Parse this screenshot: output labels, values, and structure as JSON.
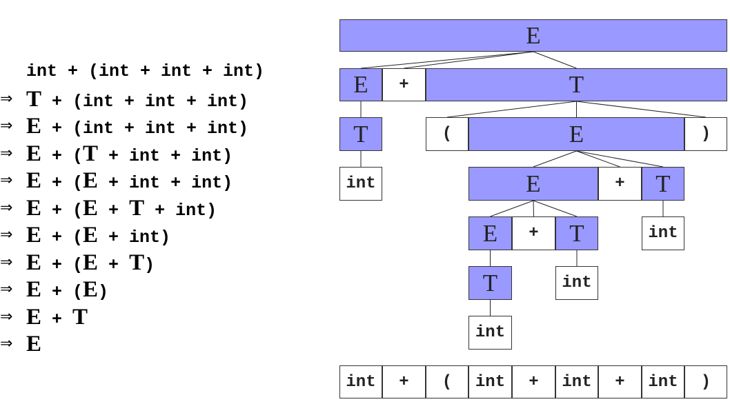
{
  "derivation": {
    "arrow": "⇒",
    "steps": [
      [
        {
          "t": "int + (int + int + int)",
          "k": "t"
        }
      ],
      [
        {
          "t": "T",
          "k": "nt"
        },
        {
          "t": " + (int + int + int)",
          "k": "t"
        }
      ],
      [
        {
          "t": "E",
          "k": "nt"
        },
        {
          "t": " + (int + int + int)",
          "k": "t"
        }
      ],
      [
        {
          "t": "E",
          "k": "nt"
        },
        {
          "t": " + (",
          "k": "t"
        },
        {
          "t": "T",
          "k": "nt"
        },
        {
          "t": " + int + int)",
          "k": "t"
        }
      ],
      [
        {
          "t": "E",
          "k": "nt"
        },
        {
          "t": " + (",
          "k": "t"
        },
        {
          "t": "E",
          "k": "nt"
        },
        {
          "t": " + int + int)",
          "k": "t"
        }
      ],
      [
        {
          "t": "E",
          "k": "nt"
        },
        {
          "t": " + (",
          "k": "t"
        },
        {
          "t": "E",
          "k": "nt"
        },
        {
          "t": " + ",
          "k": "t"
        },
        {
          "t": "T",
          "k": "nt"
        },
        {
          "t": " + int)",
          "k": "t"
        }
      ],
      [
        {
          "t": "E",
          "k": "nt"
        },
        {
          "t": " + (",
          "k": "t"
        },
        {
          "t": "E",
          "k": "nt"
        },
        {
          "t": " + int)",
          "k": "t"
        }
      ],
      [
        {
          "t": "E",
          "k": "nt"
        },
        {
          "t": " + (",
          "k": "t"
        },
        {
          "t": "E",
          "k": "nt"
        },
        {
          "t": " + ",
          "k": "t"
        },
        {
          "t": "T",
          "k": "nt"
        },
        {
          "t": ")",
          "k": "t"
        }
      ],
      [
        {
          "t": "E",
          "k": "nt"
        },
        {
          "t": " + (",
          "k": "t"
        },
        {
          "t": "E",
          "k": "nt"
        },
        {
          "t": ")",
          "k": "t"
        }
      ],
      [
        {
          "t": "E",
          "k": "nt"
        },
        {
          "t": " + ",
          "k": "t"
        },
        {
          "t": "T",
          "k": "nt"
        }
      ],
      [
        {
          "t": "E",
          "k": "nt"
        }
      ]
    ]
  },
  "parse_tree": {
    "nonterminal_color": "#9999ff",
    "terminal_color": "#ffffff",
    "nodes": [
      {
        "id": "root",
        "label": "E",
        "kind": "nt"
      },
      {
        "id": "n1",
        "label": "E",
        "kind": "nt",
        "parent": "root"
      },
      {
        "id": "n2",
        "label": "+",
        "kind": "t",
        "parent": "root"
      },
      {
        "id": "n3",
        "label": "T",
        "kind": "nt",
        "parent": "root"
      },
      {
        "id": "n4",
        "label": "T",
        "kind": "nt",
        "parent": "n1"
      },
      {
        "id": "n5",
        "label": "int",
        "kind": "t",
        "parent": "n4"
      },
      {
        "id": "n6",
        "label": "(",
        "kind": "t",
        "parent": "n3"
      },
      {
        "id": "n7",
        "label": "E",
        "kind": "nt",
        "parent": "n3"
      },
      {
        "id": "n8",
        "label": ")",
        "kind": "t",
        "parent": "n3"
      },
      {
        "id": "n9",
        "label": "E",
        "kind": "nt",
        "parent": "n7"
      },
      {
        "id": "n10",
        "label": "+",
        "kind": "t",
        "parent": "n7"
      },
      {
        "id": "n11",
        "label": "T",
        "kind": "nt",
        "parent": "n7"
      },
      {
        "id": "n12",
        "label": "E",
        "kind": "nt",
        "parent": "n9"
      },
      {
        "id": "n13",
        "label": "+",
        "kind": "t",
        "parent": "n9"
      },
      {
        "id": "n14",
        "label": "T",
        "kind": "nt",
        "parent": "n9"
      },
      {
        "id": "n15",
        "label": "int",
        "kind": "t",
        "parent": "n11"
      },
      {
        "id": "n16",
        "label": "T",
        "kind": "nt",
        "parent": "n12"
      },
      {
        "id": "n17",
        "label": "int",
        "kind": "t",
        "parent": "n14"
      },
      {
        "id": "n18",
        "label": "int",
        "kind": "t",
        "parent": "n16"
      }
    ]
  },
  "token_row": [
    "int",
    "+",
    "(",
    "int",
    "+",
    "int",
    "+",
    "int",
    ")"
  ]
}
